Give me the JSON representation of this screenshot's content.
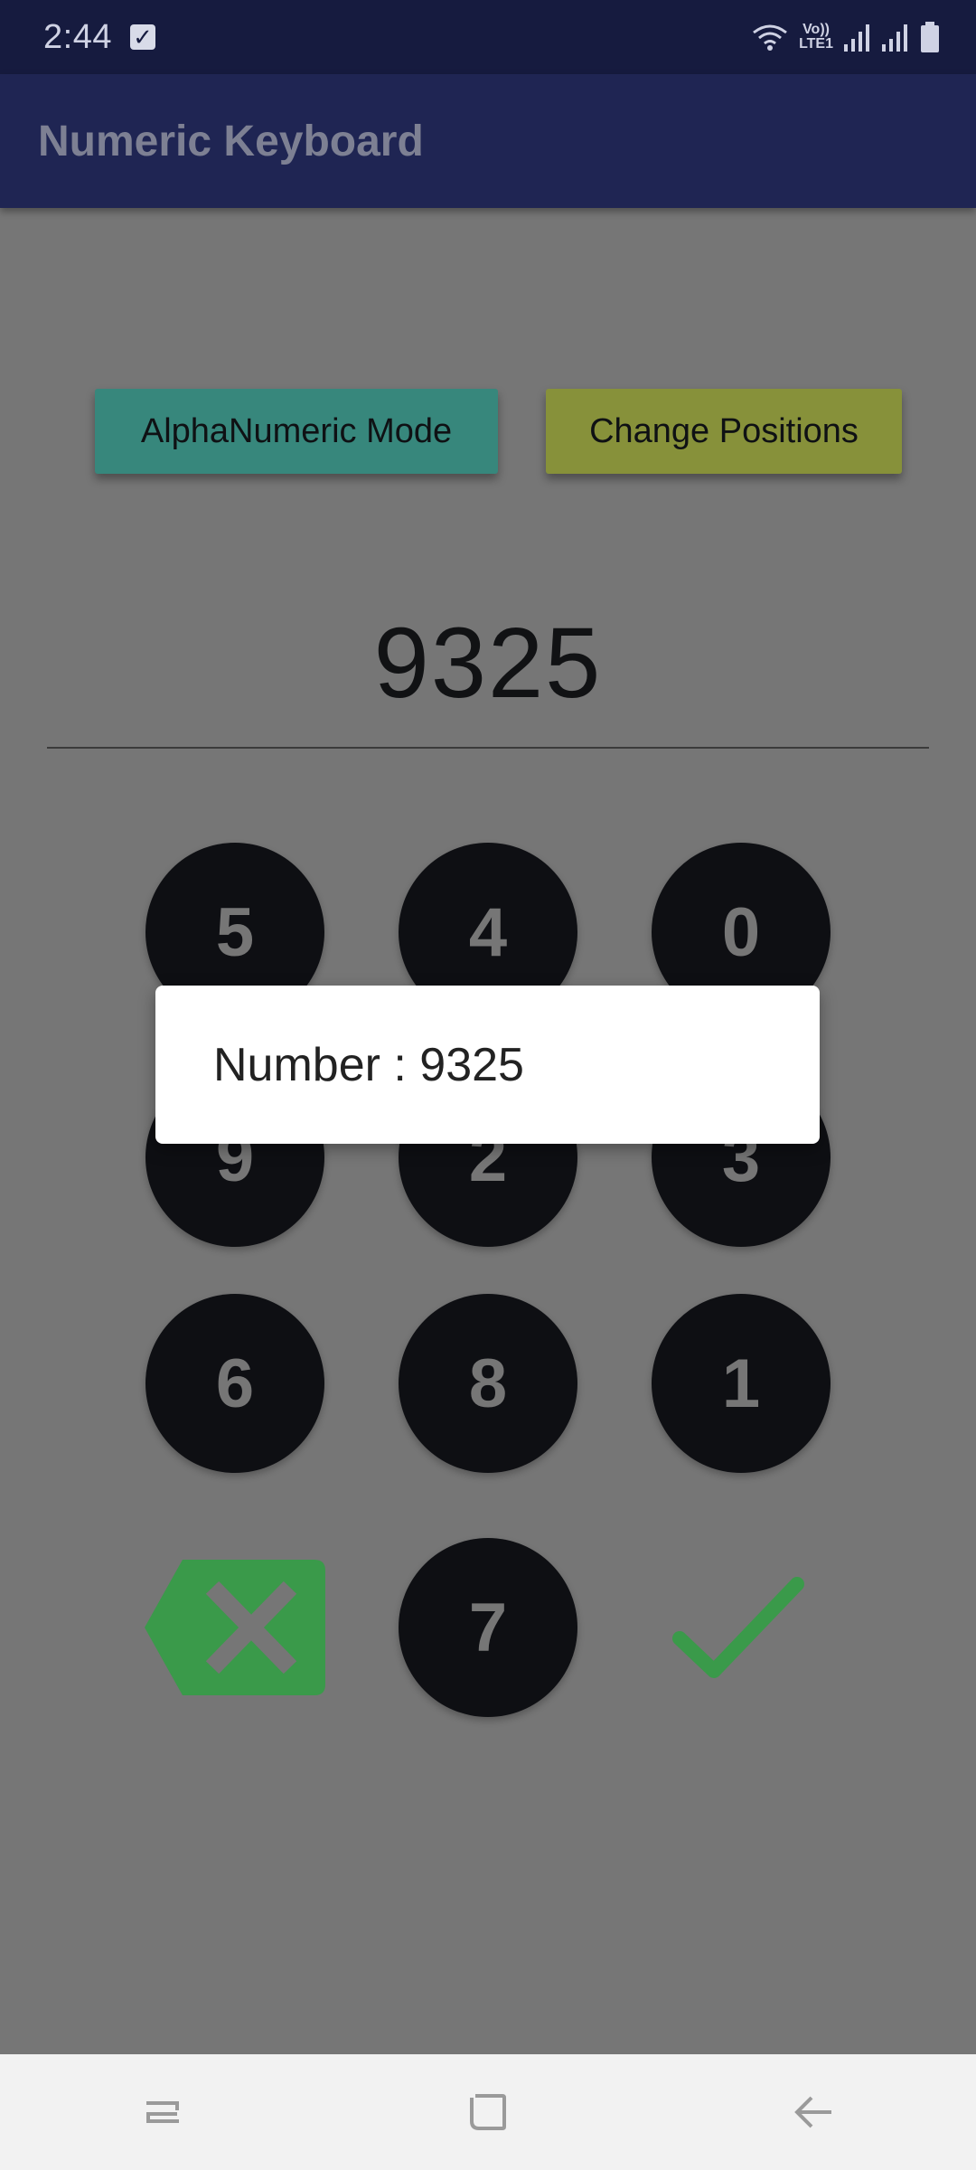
{
  "status_bar": {
    "time": "2:44",
    "volte_line1": "Vo))",
    "volte_line2": "LTE1"
  },
  "app_bar": {
    "title": "Numeric Keyboard"
  },
  "buttons": {
    "alpha_mode": "AlphaNumeric Mode",
    "change_positions": "Change Positions"
  },
  "input": {
    "value": "9325"
  },
  "keypad": {
    "keys": [
      "5",
      "4",
      "0",
      "9",
      "2",
      "3",
      "6",
      "8",
      "1",
      "7"
    ]
  },
  "toast": {
    "message": "Number : 9325"
  },
  "colors": {
    "status_bar": "#161b3f",
    "app_bar": "#1f2553",
    "alpha_button": "#37877c",
    "change_button": "#87913a",
    "key": "#0e0f13",
    "accent_green": "#3a9a4a"
  },
  "icons": {
    "backspace": "backspace-x-icon",
    "confirm": "check-icon",
    "nav_recent": "recents-icon",
    "nav_home": "home-icon",
    "nav_back": "back-icon"
  }
}
